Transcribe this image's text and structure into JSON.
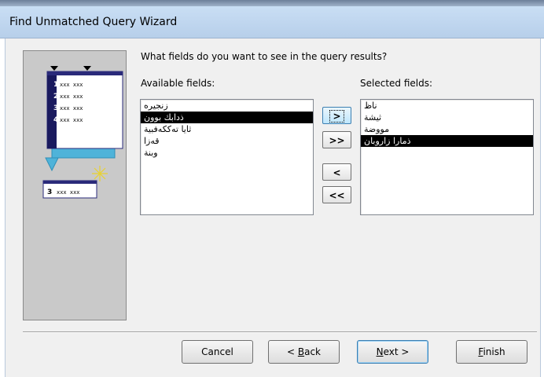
{
  "window": {
    "title": "Find Unmatched Query Wizard"
  },
  "wizard": {
    "prompt": "What fields do you want to see in the query results?",
    "available_label": "Available fields:",
    "selected_label": "Selected fields:",
    "available_fields": [
      {
        "label": "زنجيره",
        "selected": false
      },
      {
        "label": "ذدابك بوون",
        "selected": true
      },
      {
        "label": "ثايا تەككەفبية",
        "selected": false
      },
      {
        "label": "قەزا",
        "selected": false
      },
      {
        "label": "وبنة",
        "selected": false
      }
    ],
    "selected_fields": [
      {
        "label": "ناظ",
        "selected": false
      },
      {
        "label": "ثيشة",
        "selected": false
      },
      {
        "label": "مووضة",
        "selected": false
      },
      {
        "label": "ذمارا زاروبان",
        "selected": true
      }
    ],
    "move_buttons": {
      "add_one": ">",
      "add_all": ">>",
      "remove_one": "<",
      "remove_all": "<<"
    },
    "illustration": {
      "top_rows": [
        "1",
        "2",
        "3",
        "4"
      ],
      "result_row": "3",
      "cell_text": "xxx xxx"
    }
  },
  "footer": {
    "cancel": "Cancel",
    "back_prefix": "< ",
    "back_mnemonic": "B",
    "back_rest": "ack",
    "next_mnemonic": "N",
    "next_rest": "ext >",
    "finish_mnemonic": "F",
    "finish_rest": "inish"
  },
  "colors": {
    "titlebar": "#c9def4",
    "dialog_bg": "#f0f0f0",
    "selection_bg": "#000000",
    "illus_arrow": "#4fb3d9",
    "illus_table_header": "#2a2a7a"
  }
}
